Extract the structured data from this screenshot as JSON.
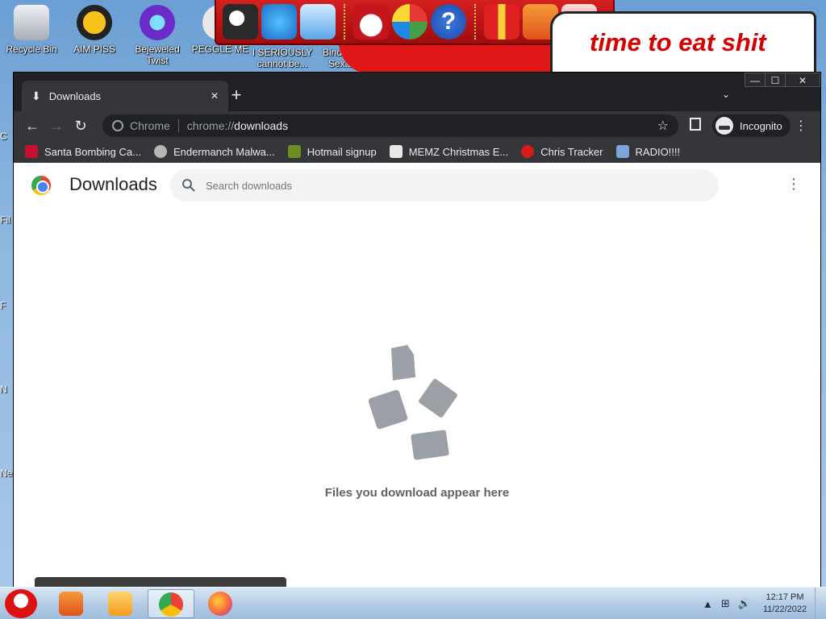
{
  "desktop": {
    "icons": [
      {
        "label": "Recycle Bin",
        "icon": "recycle-bin-icon",
        "color": "#c9ccd1"
      },
      {
        "label": "AIM PISS",
        "icon": "aim-icon",
        "color": "#f2a40c"
      },
      {
        "label": "Bejeweled Twist",
        "icon": "bejeweled-icon",
        "color": "#7b40c9"
      },
      {
        "label": "PEGGLE ME",
        "icon": "peggle-icon",
        "color": "#e4e4e4"
      },
      {
        "label": "I SERIOUSLY cannot be...",
        "icon": "file-icon",
        "color": "#e6e6e6"
      },
      {
        "label": "Binding Of Sex.swf",
        "icon": "swf-icon",
        "color": "#e6e6e6"
      }
    ],
    "edge_labels": [
      "C",
      "Fil",
      "F",
      "N",
      "Ne"
    ],
    "meme_text": "time to eat shit",
    "banner_icons": [
      "santa-computer-icon",
      "globe-computer-icon",
      "network-icon",
      "snowman-icon",
      "windows-update-icon",
      "help-icon",
      "gift-icon",
      "folder-icon",
      "trash-icon"
    ]
  },
  "browser": {
    "tab": {
      "title": "Downloads",
      "close": "✕"
    },
    "new_tab": "+",
    "tab_search": "⌄",
    "window_controls": {
      "minimize": "—",
      "maximize": "☐",
      "close": "✕"
    },
    "toolbar": {
      "back": "←",
      "forward": "→",
      "reload": "↻"
    },
    "omnibox": {
      "site_label": "Chrome",
      "url_scheme": "chrome://",
      "url_host": "downloads",
      "star": "☆"
    },
    "profile": {
      "label": "Incognito"
    },
    "menu": "⋮",
    "bookmarks": [
      {
        "label": "Santa Bombing Ca...",
        "icon": "santa-icon",
        "color": "#c8102e"
      },
      {
        "label": "Endermanch Malwa...",
        "icon": "enderman-icon",
        "color": "#b5b5b5"
      },
      {
        "label": "Hotmail signup",
        "icon": "hotmail-icon",
        "color": "#6b8e23"
      },
      {
        "label": "MEMZ Christmas E...",
        "icon": "memz-icon",
        "color": "#e8e8e8"
      },
      {
        "label": "Chris Tracker",
        "icon": "star-icon",
        "color": "#d81b1b"
      },
      {
        "label": "RADIO!!!!",
        "icon": "radio-icon",
        "color": "#7aa6d9"
      }
    ]
  },
  "downloads_page": {
    "title": "Downloads",
    "search_placeholder": "Search downloads",
    "more": "⋮",
    "empty_message": "Files you download appear here"
  },
  "taskbar": {
    "apps": [
      {
        "name": "file-explorer",
        "icon": "folder-icon",
        "color": "#e8572a",
        "active": false
      },
      {
        "name": "media-player",
        "icon": "media-player-icon",
        "color": "#f29c1f",
        "active": false
      },
      {
        "name": "chrome",
        "icon": "chrome-icon",
        "color": "#4285f4",
        "active": true
      },
      {
        "name": "firefox",
        "icon": "firefox-icon",
        "color": "#ff7139",
        "active": false
      }
    ],
    "tray": {
      "up_arrow": "▲",
      "network": "⊞",
      "volume": "🔊"
    },
    "time": "12:17 PM",
    "date": "11/22/2022"
  }
}
